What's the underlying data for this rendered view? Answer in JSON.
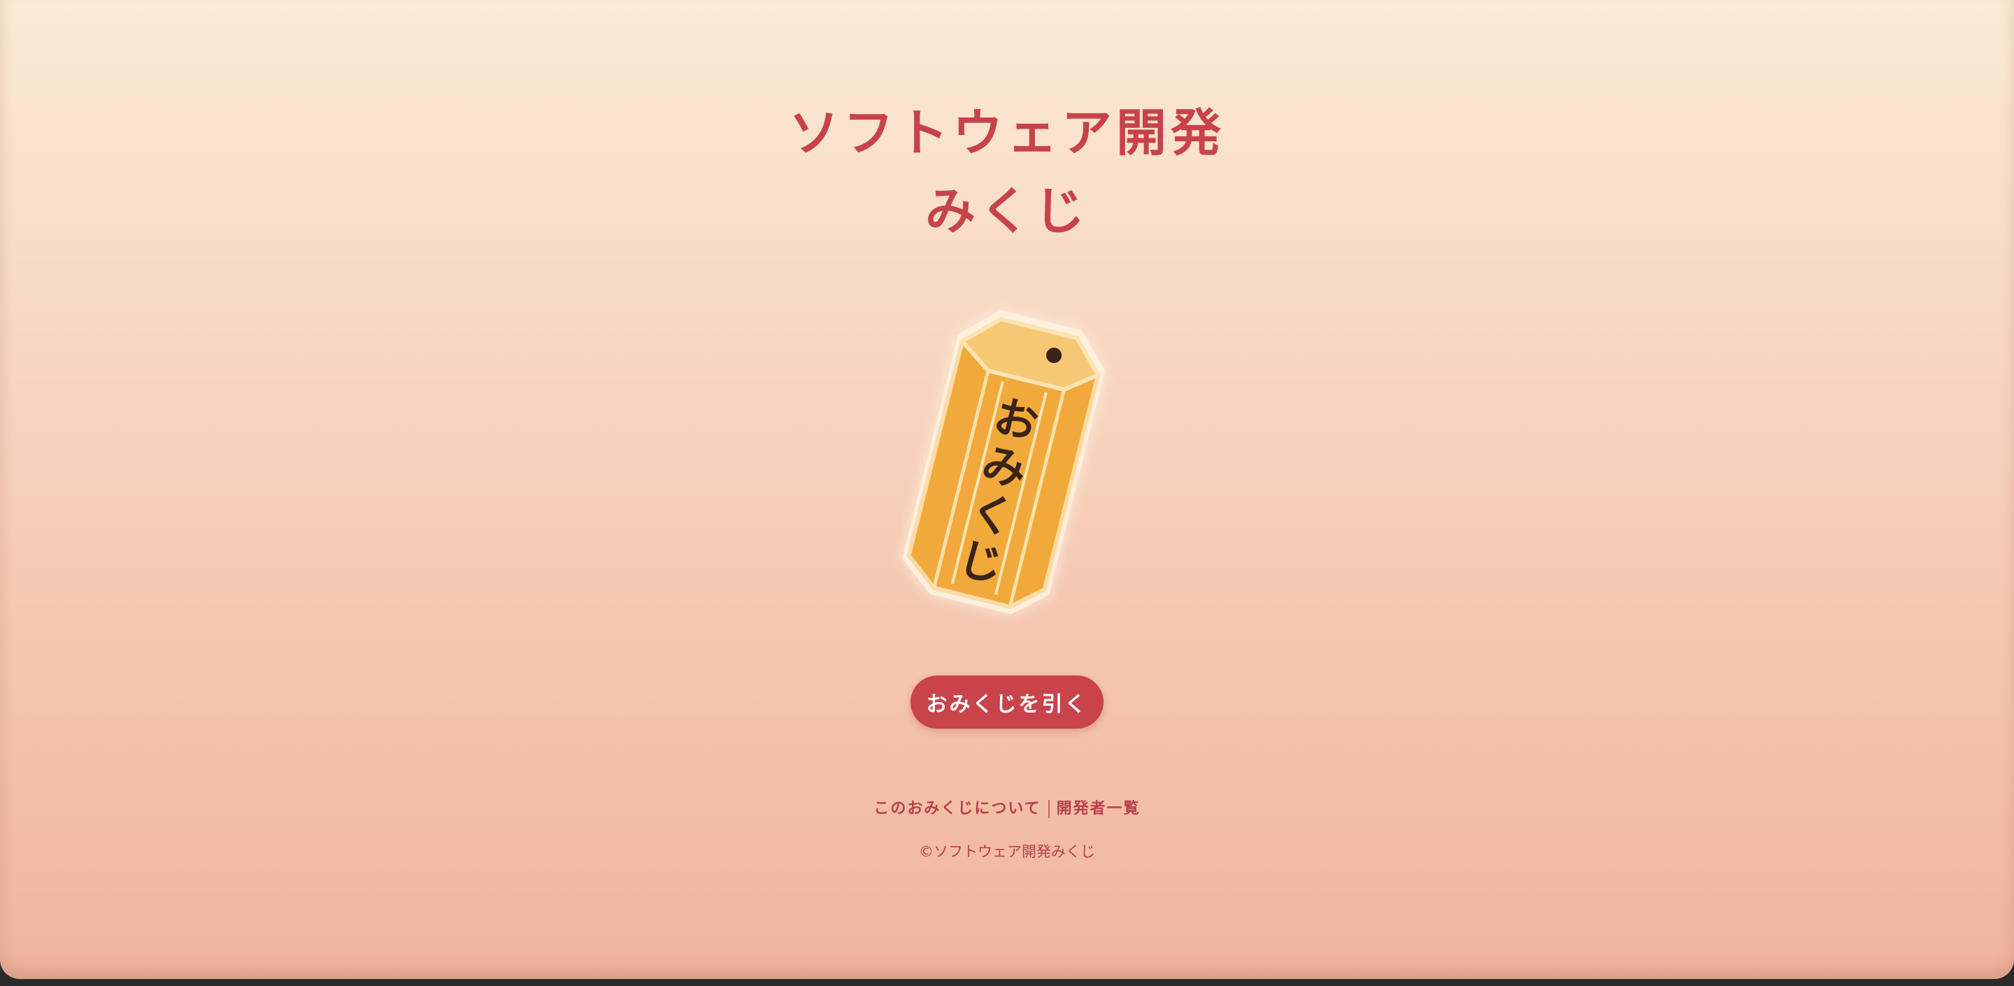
{
  "header": {
    "title_line1": "ソフトウェア開発",
    "title_line2": "みくじ"
  },
  "illustration": {
    "label": "おみくじ",
    "body_color": "#f2a93b",
    "top_color": "#f7c873",
    "text_color": "#3a2418"
  },
  "actions": {
    "draw_button_label": "おみくじを引く",
    "button_color": "#c9434b"
  },
  "footer": {
    "about_link": "このおみくじについて",
    "developers_link": "開発者一覧",
    "copyright": "©ソフトウェア開発みくじ"
  },
  "theme": {
    "gradient_top": "#fbead4",
    "gradient_bottom": "#f0b59e",
    "accent": "#c8424a"
  }
}
